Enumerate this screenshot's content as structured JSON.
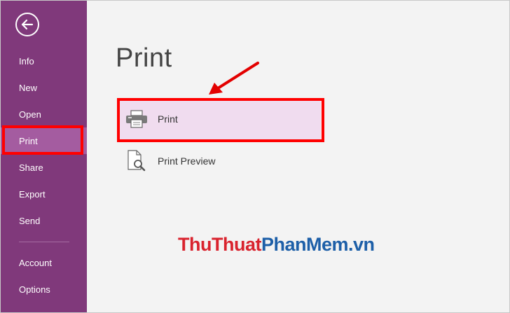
{
  "sidebar": {
    "back_icon": "back-arrow-icon",
    "items": [
      {
        "label": "Info"
      },
      {
        "label": "New"
      },
      {
        "label": "Open"
      },
      {
        "label": "Print"
      },
      {
        "label": "Share"
      },
      {
        "label": "Export"
      },
      {
        "label": "Send"
      },
      {
        "label": "Account"
      },
      {
        "label": "Options"
      }
    ],
    "active_item": "Print"
  },
  "main": {
    "title": "Print",
    "options": [
      {
        "label": "Print",
        "icon": "printer-icon"
      },
      {
        "label": "Print Preview",
        "icon": "print-preview-icon"
      }
    ]
  },
  "watermark": {
    "part1": "ThuThuat",
    "part2": "PhanMem.vn"
  },
  "colors": {
    "sidebar_bg": "#80397b",
    "sidebar_active": "#a45ca0",
    "selected_option_bg": "#f0dcef",
    "highlight_red": "#ff0000",
    "watermark_red": "#d9232e",
    "watermark_blue": "#1d5fa8"
  }
}
